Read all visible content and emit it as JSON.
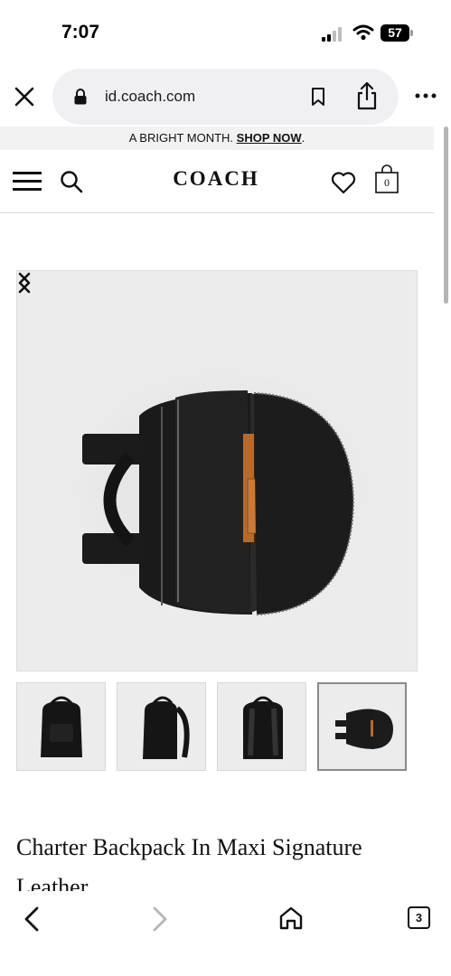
{
  "status_bar": {
    "time": "7:07",
    "battery": "57"
  },
  "browser": {
    "url": "id.coach.com",
    "icons": [
      "close-icon",
      "lock-icon",
      "bookmark-icon",
      "share-icon",
      "more-icon"
    ]
  },
  "promo": {
    "text": "A BRIGHT MONTH. ",
    "link": "SHOP NOW",
    "suffix": "."
  },
  "header": {
    "logo": "COACH",
    "bag_count": "0",
    "icons": [
      "menu-icon",
      "search-icon",
      "heart-icon",
      "shopping-bag-icon"
    ]
  },
  "gallery": {
    "thumbnail_count": 4,
    "active_thumbnail": 4,
    "icons": [
      "chevron-left-icon",
      "chevron-right-icon"
    ]
  },
  "product": {
    "title": "Charter Backpack In Maxi Signature Leather"
  },
  "toolbar": {
    "tabs_count": "3",
    "icons": [
      "back-arrow-icon",
      "forward-arrow-icon",
      "home-icon",
      "tabs-icon"
    ]
  },
  "colors": {
    "accent": "#111111",
    "image_background": "#ececec",
    "url_pill": "#f0f0f2",
    "promo_background": "#f2f2f2",
    "leather_interior_tan": "#b86a2c"
  }
}
